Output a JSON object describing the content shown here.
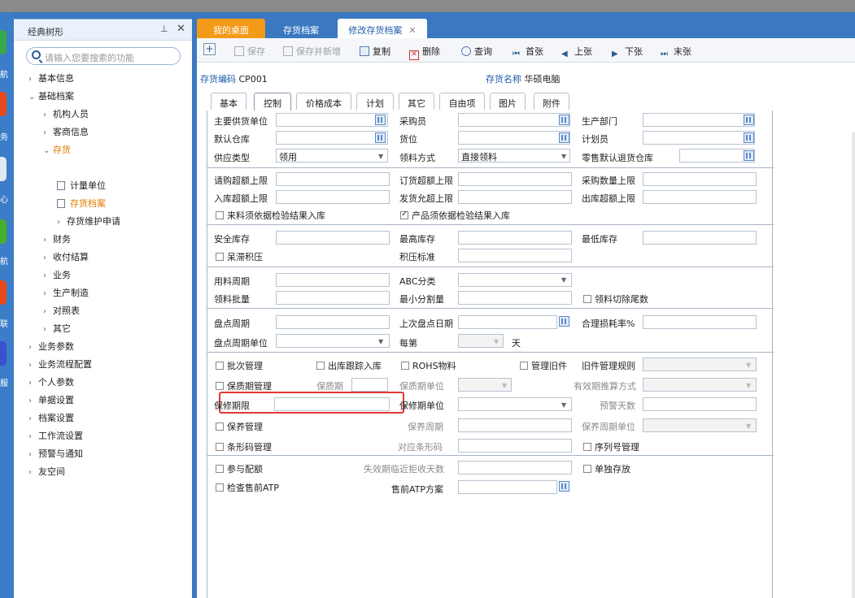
{
  "left_strip": {
    "chars": [
      "航",
      "务",
      "心",
      "航",
      "联",
      "服"
    ]
  },
  "tree": {
    "title": "经典树形",
    "pin": "📌",
    "close": "✕",
    "search_placeholder": "请输入您要搜索的功能",
    "items": [
      {
        "label": "基本信息"
      },
      {
        "label": "基础档案"
      },
      {
        "label": "机构人员"
      },
      {
        "label": "客商信息"
      },
      {
        "label": "存货"
      },
      {
        "label": "计量单位"
      },
      {
        "label": "存货档案"
      },
      {
        "label": "存货维护申请"
      },
      {
        "label": "财务"
      },
      {
        "label": "收付结算"
      },
      {
        "label": "业务"
      },
      {
        "label": "生产制造"
      },
      {
        "label": "对照表"
      },
      {
        "label": "其它"
      },
      {
        "label": "业务参数"
      },
      {
        "label": "业务流程配置"
      },
      {
        "label": "个人参数"
      },
      {
        "label": "单据设置"
      },
      {
        "label": "档案设置"
      },
      {
        "label": "工作流设置"
      },
      {
        "label": "预警与通知"
      },
      {
        "label": "友空间"
      }
    ]
  },
  "tabs": [
    "我的桌面",
    "存货档案",
    "修改存货档案"
  ],
  "toolbar": {
    "save": "保存",
    "save_new": "保存并新增",
    "copy": "复制",
    "delete": "删除",
    "query": "查询",
    "first": "首张",
    "prev": "上张",
    "next": "下张",
    "last": "末张"
  },
  "header": {
    "code_label": "存货编码",
    "code_value": "CP001",
    "name_label": "存货名称",
    "name_value": "华硕电脑"
  },
  "form_tabs": [
    "基本",
    "控制",
    "价格成本",
    "计划",
    "其它",
    "自由项",
    "图片",
    "附件"
  ],
  "form": {
    "main_supplier": "主要供货单位",
    "buyer": "采购员",
    "prod_dept": "生产部门",
    "default_wh": "默认仓库",
    "location": "货位",
    "planner": "计划员",
    "supply_type": "供应类型",
    "supply_type_val": "领用",
    "pick_method": "领料方式",
    "pick_method_val": "直接领料",
    "retail_return_wh": "零售默认退货仓库",
    "req_over_limit": "请购超额上限",
    "order_over_limit": "订货超额上限",
    "purchase_qty_limit": "采购数量上限",
    "in_over_limit": "入库超额上限",
    "ship_over_limit": "发货允超上限",
    "out_over_limit": "出库超额上限",
    "cb_incoming_qc": "来料须依据检验结果入库",
    "cb_product_qc": "产品须依据检验结果入库",
    "safety_stock": "安全库存",
    "max_stock": "最高库存",
    "min_stock": "最低库存",
    "cb_slow_moving": "呆滞积压",
    "backlog_std": "积压标准",
    "usage_cycle": "用料周期",
    "abc": "ABC分类",
    "pick_batch": "领料批量",
    "min_split": "最小分割量",
    "cb_pick_trim": "领料切除尾数",
    "count_cycle": "盘点周期",
    "last_count_date": "上次盘点日期",
    "reasonable_loss": "合理损耗率%",
    "count_cycle_unit": "盘点周期单位",
    "every": "每第",
    "day": "天",
    "cb_batch": "批次管理",
    "cb_out_trace": "出库跟踪入库",
    "cb_rohs": "ROHS物料",
    "cb_old_parts": "管理旧件",
    "old_parts_rule": "旧件管理规则",
    "cb_shelf_life": "保质期管理",
    "shelf_life": "保质期",
    "shelf_unit": "保质期单位",
    "expiry_method": "有效期推算方式",
    "warranty": "保修期限",
    "warranty_unit": "保修期单位",
    "warning_days": "预警天数",
    "cb_maintenance": "保养管理",
    "maint_cycle": "保养周期",
    "maint_unit": "保养周期单位",
    "cb_barcode": "条形码管理",
    "barcode": "对应条形码",
    "cb_serial": "序列号管理",
    "cb_quota": "参与配额",
    "expiry_reject": "失效期临近拒收天数",
    "cb_separate": "单独存放",
    "cb_atp": "检查售前ATP",
    "atp_scheme": "售前ATP方案"
  },
  "colors": {
    "accent": "#f39a18",
    "brand": "#3a78c2",
    "highlight": "#e53535"
  }
}
